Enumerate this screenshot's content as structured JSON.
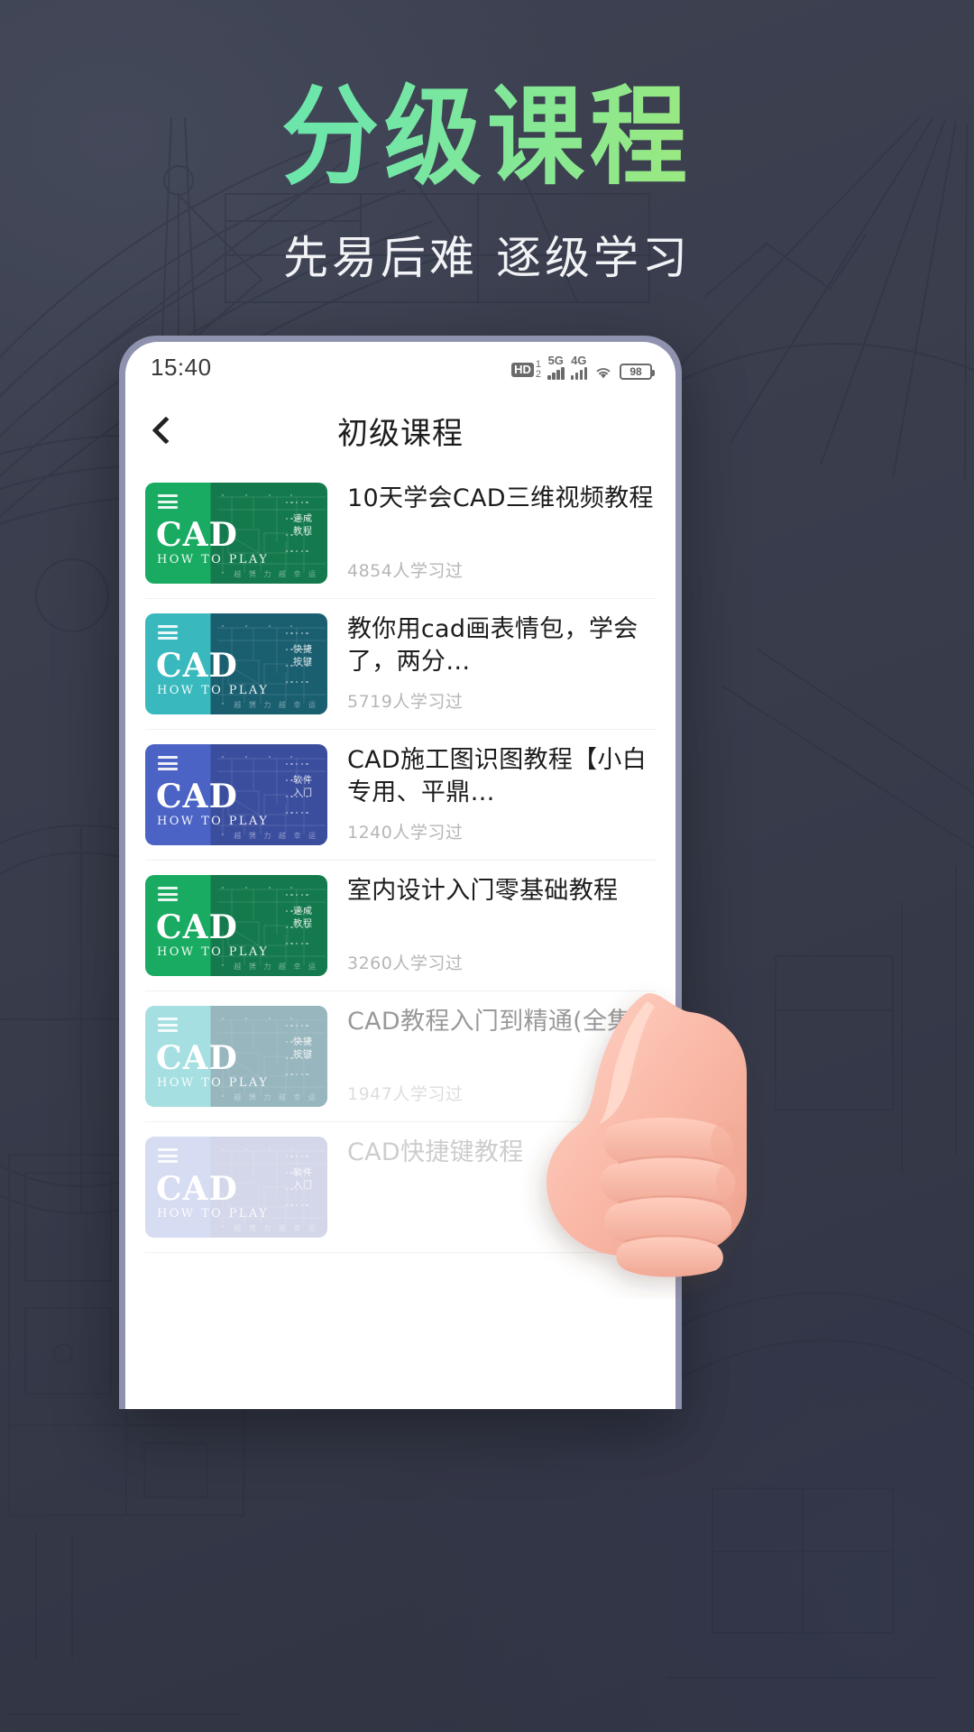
{
  "poster": {
    "headline": "分级课程",
    "subtitle": "先易后难  逐级学习",
    "headline_gradient_from": "#57e3b0",
    "headline_gradient_to": "#a7eb76",
    "background_color": "#3b3f4e"
  },
  "phone": {
    "status_bar": {
      "time": "15:40",
      "hd_label": "HD",
      "hd_sub_top": "1",
      "hd_sub_bottom": "2",
      "net_5g": "5G",
      "net_4g": "4G",
      "wifi_icon": "wifi-icon",
      "battery_level": "98"
    },
    "nav": {
      "back_icon": "chevron-left-icon",
      "title": "初级课程"
    },
    "courses": [
      {
        "title": "10天学会CAD三维视频教程",
        "learners": "4854人学习过",
        "thumb": {
          "brand": "CAD",
          "tagline": "HOW TO PLAY",
          "vertical_label_1": "速成",
          "vertical_label_2": "教程",
          "footer": "越 努 力 越 幸 运",
          "menu_icon": "hamburger-icon",
          "color_left": "#1aab62",
          "color_right": "#147a4d"
        }
      },
      {
        "title": "教你用cad画表情包，学会了，两分…",
        "learners": "5719人学习过",
        "thumb": {
          "brand": "CAD",
          "tagline": "HOW TO PLAY",
          "vertical_label_1": "快捷",
          "vertical_label_2": "按键",
          "footer": "越 努 力 越 幸 运",
          "menu_icon": "hamburger-icon",
          "color_left": "#39b9bd",
          "color_right": "#1a5f70"
        }
      },
      {
        "title": "CAD施工图识图教程【小白专用、平鼎…",
        "learners": "1240人学习过",
        "thumb": {
          "brand": "CAD",
          "tagline": "HOW TO PLAY",
          "vertical_label_1": "软件",
          "vertical_label_2": "入门",
          "footer": "越 努 力 越 幸 运",
          "menu_icon": "hamburger-icon",
          "color_left": "#4a63c4",
          "color_right": "#3b4e9e"
        }
      },
      {
        "title": "室内设计入门零基础教程",
        "learners": "3260人学习过",
        "thumb": {
          "brand": "CAD",
          "tagline": "HOW TO PLAY",
          "vertical_label_1": "速成",
          "vertical_label_2": "教程",
          "footer": "越 努 力 越 幸 运",
          "menu_icon": "hamburger-icon",
          "color_left": "#1aab62",
          "color_right": "#147a4d"
        }
      },
      {
        "title": "CAD教程入门到精通(全集)",
        "learners": "1947人学习过",
        "thumb": {
          "brand": "CAD",
          "tagline": "HOW TO PLAY",
          "vertical_label_1": "快捷",
          "vertical_label_2": "按键",
          "footer": "越 努 力 越 幸 运",
          "menu_icon": "hamburger-icon",
          "color_left": "#39b9bd",
          "color_right": "#1a5f70"
        }
      },
      {
        "title": "CAD快捷键教程",
        "learners": "",
        "thumb": {
          "brand": "CAD",
          "tagline": "HOW TO PLAY",
          "vertical_label_1": "软件",
          "vertical_label_2": "入门",
          "footer": "越 努 力 越 幸 运",
          "menu_icon": "hamburger-icon",
          "color_left": "#4a63c4",
          "color_right": "#3b4e9e"
        }
      }
    ]
  },
  "decoration": {
    "hand_icon": "thumbs-up-hand-icon"
  }
}
